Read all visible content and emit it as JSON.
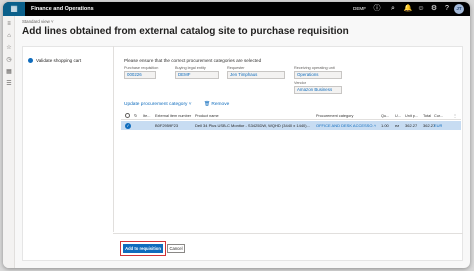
{
  "topbar": {
    "app_title": "Finance and Operations",
    "company": "DEMF",
    "waffle_icon": "▦",
    "icons": [
      "help-circle-icon",
      "search-icon",
      "bell-icon",
      "smiley-icon",
      "gear-icon",
      "question-icon"
    ],
    "glyphs": [
      "ⓘ",
      "⌕",
      "🔔",
      "☺",
      "⚙",
      "?"
    ],
    "avatar": "JT"
  },
  "leftrail": {
    "glyphs": [
      "≡",
      "⌂",
      "☆",
      "◷",
      "▦",
      "☰"
    ]
  },
  "header": {
    "view_label": "Standard view ˅",
    "title": "Add lines obtained from external catalog site to purchase requisition"
  },
  "steps": [
    {
      "label": "Validate shopping cart"
    }
  ],
  "form": {
    "notice": "Please ensure that the correct procurement categories are selected",
    "purchase_requisition": {
      "label": "Purchase requisition",
      "value": "000226"
    },
    "buying_legal_entity": {
      "label": "Buying legal entity",
      "value": "DEMF"
    },
    "requester": {
      "label": "Requester",
      "value": "Jen Timphaus"
    },
    "receiving_operating_unit": {
      "label": "Receiving operating unit",
      "value": "Operations"
    },
    "vendor": {
      "label": "Vendor",
      "value": "Amazon Business"
    }
  },
  "actions": {
    "update_category": "Update procurement category ˅",
    "remove": "🗑 Remove"
  },
  "grid": {
    "columns": [
      "Ite...",
      "External item number",
      "Product name",
      "Procurement category",
      "Qu...",
      "U...",
      "Unit p...",
      "Total",
      "Cur..."
    ],
    "rows": [
      {
        "external_item_number": "B0F2959F23",
        "product_name": "Dell 34 Plus USB-C Monitor - S3425DW, WQHD (3440 x 1440)...",
        "procurement_category": "OFFICE AND DESK ACCESSO...",
        "quantity": "1.00",
        "unit": "ea",
        "unit_price": "362.27",
        "total": "362.27",
        "currency": "EUR"
      }
    ]
  },
  "footer": {
    "add_button": "Add to requisition",
    "cancel_button": "Cancel"
  },
  "colors": {
    "accent": "#0f6cbd",
    "highlight": "#d13438",
    "row_selected": "#c7dcf2"
  }
}
